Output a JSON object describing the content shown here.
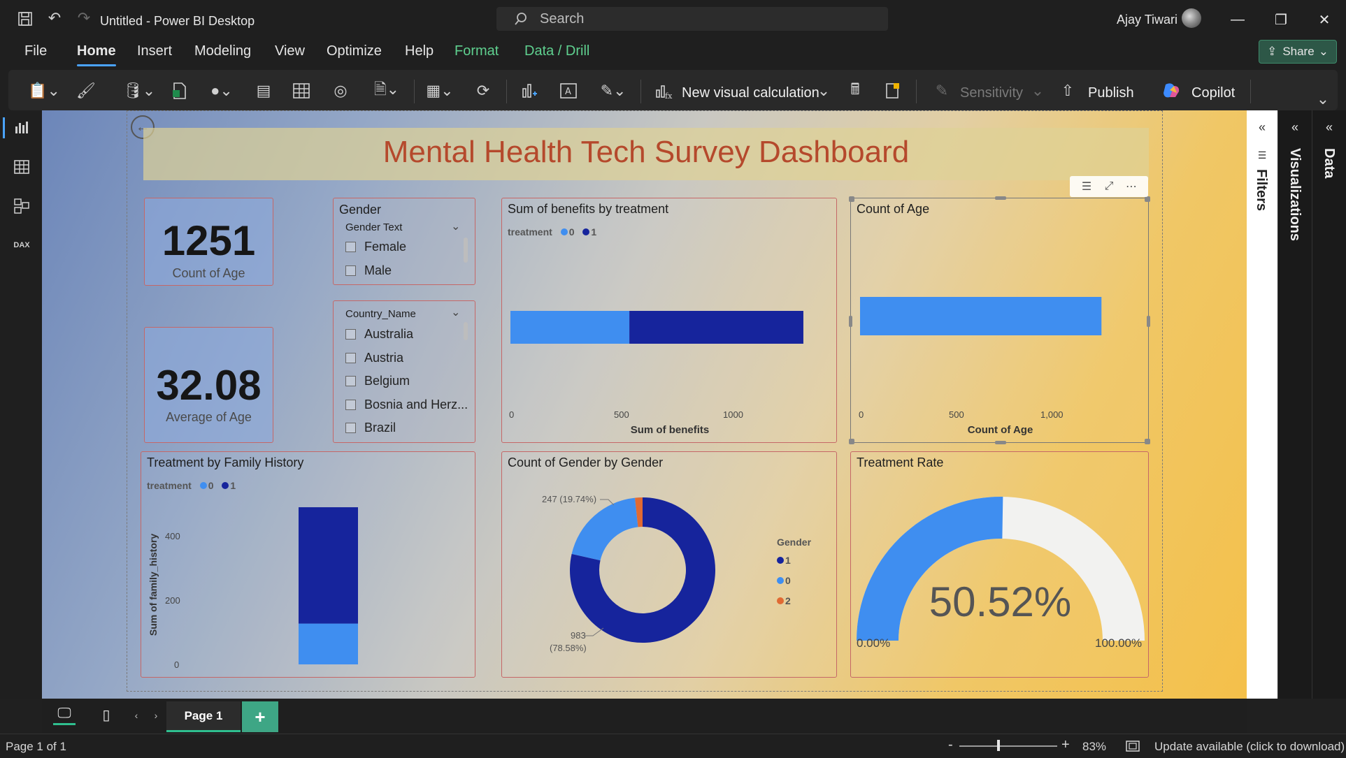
{
  "window": {
    "title": "Untitled - Power BI Desktop",
    "search_placeholder": "Search",
    "user": "Ajay Tiwari"
  },
  "menu": {
    "items": [
      "File",
      "Home",
      "Insert",
      "Modeling",
      "View",
      "Optimize",
      "Help",
      "Format",
      "Data / Drill"
    ],
    "share": "Share"
  },
  "ribbon": {
    "new_visual_calculation": "New visual calculation",
    "sensitivity": "Sensitivity",
    "publish": "Publish",
    "copilot": "Copilot"
  },
  "dashboard": {
    "title": "Mental Health Tech Survey Dashboard",
    "kpi_count": {
      "value": "1251",
      "label": "Count of Age"
    },
    "kpi_avg": {
      "value": "32.08",
      "label": "Average of Age"
    },
    "gender_slicer": {
      "title": "Gender",
      "header": "Gender Text",
      "items": [
        "Female",
        "Male"
      ]
    },
    "country_slicer": {
      "header": "Country_Name",
      "items": [
        "Australia",
        "Austria",
        "Belgium",
        "Bosnia and Herz...",
        "Brazil"
      ]
    },
    "benefits": {
      "title": "Sum of benefits by treatment",
      "legend_title": "treatment",
      "legend": [
        "0",
        "1"
      ],
      "ticks": [
        "0",
        "500",
        "1000"
      ],
      "xlabel": "Sum of benefits"
    },
    "count_age": {
      "title": "Count of Age",
      "ticks": [
        "0",
        "500",
        "1,000"
      ],
      "xlabel": "Count of Age"
    },
    "family": {
      "title": "Treatment by Family History",
      "legend_title": "treatment",
      "legend": [
        "0",
        "1"
      ],
      "ticks": [
        "400",
        "200",
        "0"
      ],
      "ylabel": "Sum of family_history"
    },
    "gender_donut": {
      "title": "Count of Gender by Gender",
      "label_top": "247 (19.74%)",
      "label_bottom_value": "983",
      "label_bottom_pct": "(78.58%)",
      "legend_title": "Gender",
      "legend": [
        "1",
        "0",
        "2"
      ]
    },
    "treatment_rate": {
      "title": "Treatment Rate",
      "value": "50.52%",
      "min": "0.00%",
      "max": "100.00%"
    }
  },
  "panes": {
    "filters": "Filters",
    "visualizations": "Visualizations",
    "data": "Data"
  },
  "pages": {
    "tab": "Page 1"
  },
  "status": {
    "page": "Page 1 of 1",
    "zoom": "83%",
    "update": "Update available (click to download)"
  },
  "colors": {
    "series0": "#3f8ef0",
    "series1": "#16249c",
    "series2": "#e06a33",
    "title": "#b5492c",
    "card_border": "#c56767"
  },
  "chart_data": [
    {
      "type": "bar",
      "title": "Sum of benefits by treatment",
      "categories": [
        ""
      ],
      "series": [
        {
          "name": "0",
          "values": [
            540
          ]
        },
        {
          "name": "1",
          "values": [
            790
          ]
        }
      ],
      "xlabel": "Sum of benefits",
      "xlim": [
        0,
        1300
      ]
    },
    {
      "type": "bar",
      "title": "Count of Age",
      "categories": [
        ""
      ],
      "values": [
        1251
      ],
      "xlabel": "Count of Age",
      "xlim": [
        0,
        1251
      ]
    },
    {
      "type": "bar",
      "title": "Treatment by Family History",
      "categories": [
        ""
      ],
      "series": [
        {
          "name": "0",
          "values": [
            127
          ]
        },
        {
          "name": "1",
          "values": [
            362
          ]
        }
      ],
      "ylabel": "Sum of family_history",
      "ylim": [
        0,
        489
      ]
    },
    {
      "type": "pie",
      "title": "Count of Gender by Gender",
      "categories": [
        "1",
        "0",
        "2"
      ],
      "values": [
        983,
        247,
        21
      ]
    },
    {
      "type": "gauge",
      "title": "Treatment Rate",
      "value": 50.52,
      "min": 0,
      "max": 100
    }
  ]
}
